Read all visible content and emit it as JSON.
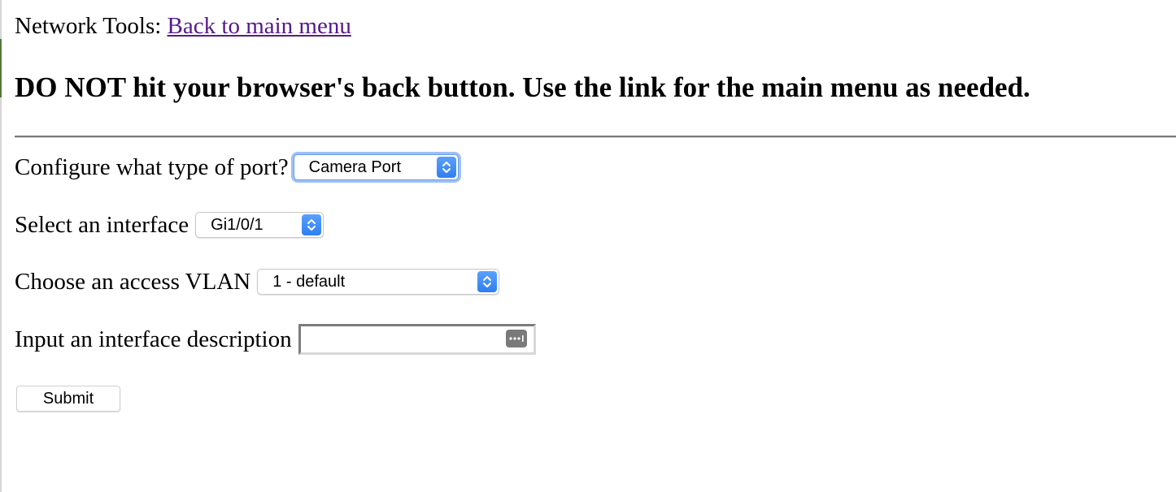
{
  "header": {
    "prefix": "Network Tools:",
    "back_link": "Back to main menu"
  },
  "warning": "DO NOT hit your browser's back button. Use the link for the main menu as needed.",
  "form": {
    "port_type": {
      "label": "Configure what type of port?",
      "selected": "Camera Port"
    },
    "interface": {
      "label": "Select an interface",
      "selected": "Gi1/0/1"
    },
    "vlan": {
      "label": "Choose an access VLAN",
      "selected": "1 - default"
    },
    "description": {
      "label": "Input an interface description",
      "value": ""
    },
    "submit_label": "Submit"
  },
  "colors": {
    "link_visited": "#551a8b",
    "select_accent": "#2f7ff0",
    "focus_ring": "#9ec0f5"
  },
  "icons": {
    "select_arrows": "chevron-up-down-icon",
    "password_key": "keychain-autofill-icon"
  }
}
